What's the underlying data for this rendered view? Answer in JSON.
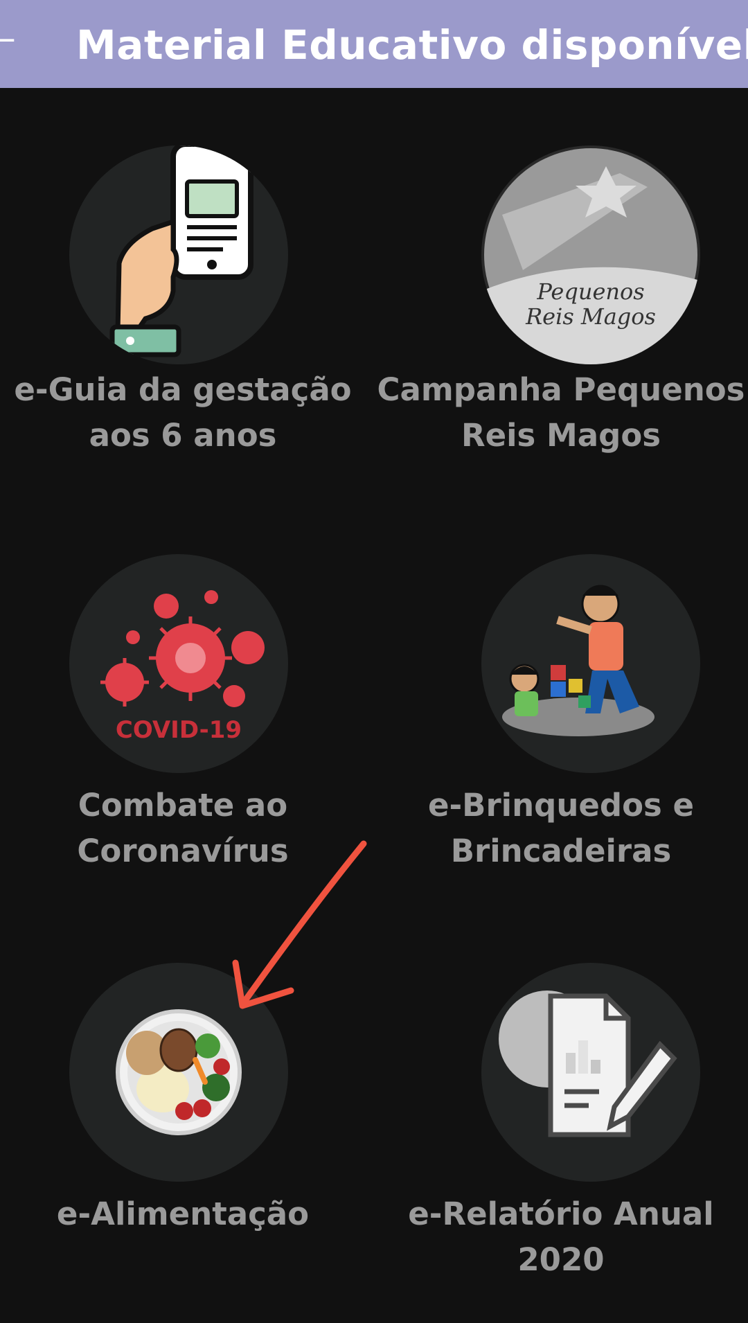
{
  "header": {
    "title": "Material Educativo disponível",
    "back_icon": "arrow-left-icon",
    "color": "#9b9acb"
  },
  "tiles": [
    {
      "label": "e-Guia da gestação\naos 6 anos",
      "icon": "phone-in-hand-icon"
    },
    {
      "label": "Campanha Pequenos\nReis Magos",
      "icon": "star-banner-icon",
      "image_text": "Pequenos\nReis Magos"
    },
    {
      "label": "Combate ao\nCoronavírus",
      "icon": "virus-icon",
      "image_text": "COVID-19"
    },
    {
      "label": "e-Brinquedos e\nBrincadeiras",
      "icon": "children-playing-icon"
    },
    {
      "label": "e-Alimentação",
      "icon": "food-plate-icon"
    },
    {
      "label": "e-Relatório Anual\n2020",
      "icon": "report-pencil-icon"
    }
  ],
  "annotation": {
    "icon": "red-arrow-annotation",
    "color": "#f0533f"
  }
}
